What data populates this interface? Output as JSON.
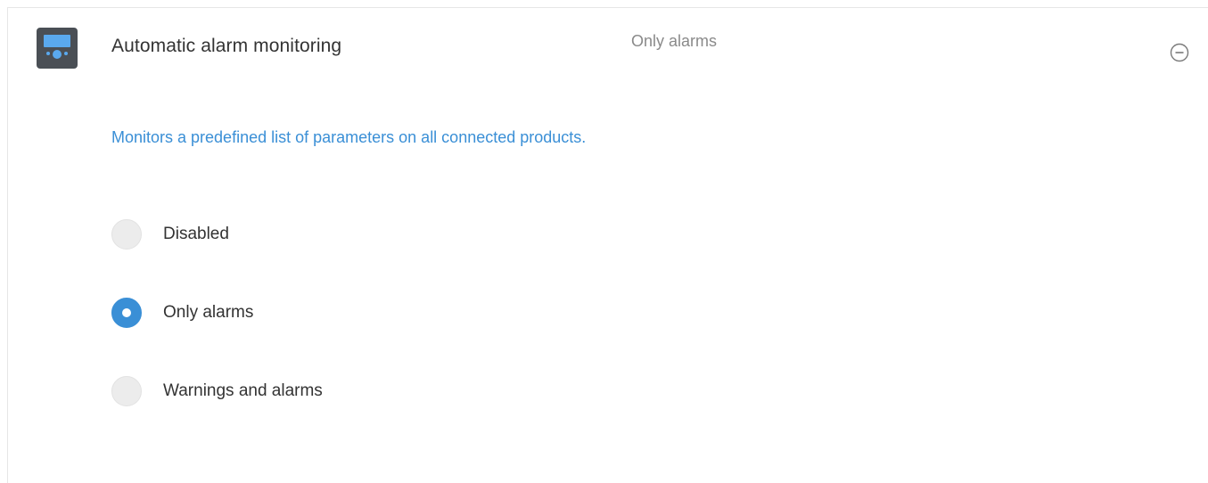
{
  "setting": {
    "title": "Automatic alarm monitoring",
    "current_value": "Only alarms",
    "description": "Monitors a predefined list of parameters on all connected products.",
    "icon": "device-screen-icon",
    "collapse_icon": "minus-circle-icon"
  },
  "options": [
    {
      "label": "Disabled",
      "checked": false
    },
    {
      "label": "Only alarms",
      "checked": true
    },
    {
      "label": "Warnings and alarms",
      "checked": false
    }
  ],
  "colors": {
    "accent": "#3a8fd6",
    "title_text": "#333333",
    "muted_text": "#8a8a8a",
    "radio_unchecked": "#ececec",
    "icon_body": "#4a4f55",
    "icon_screen": "#5aa9ee"
  }
}
